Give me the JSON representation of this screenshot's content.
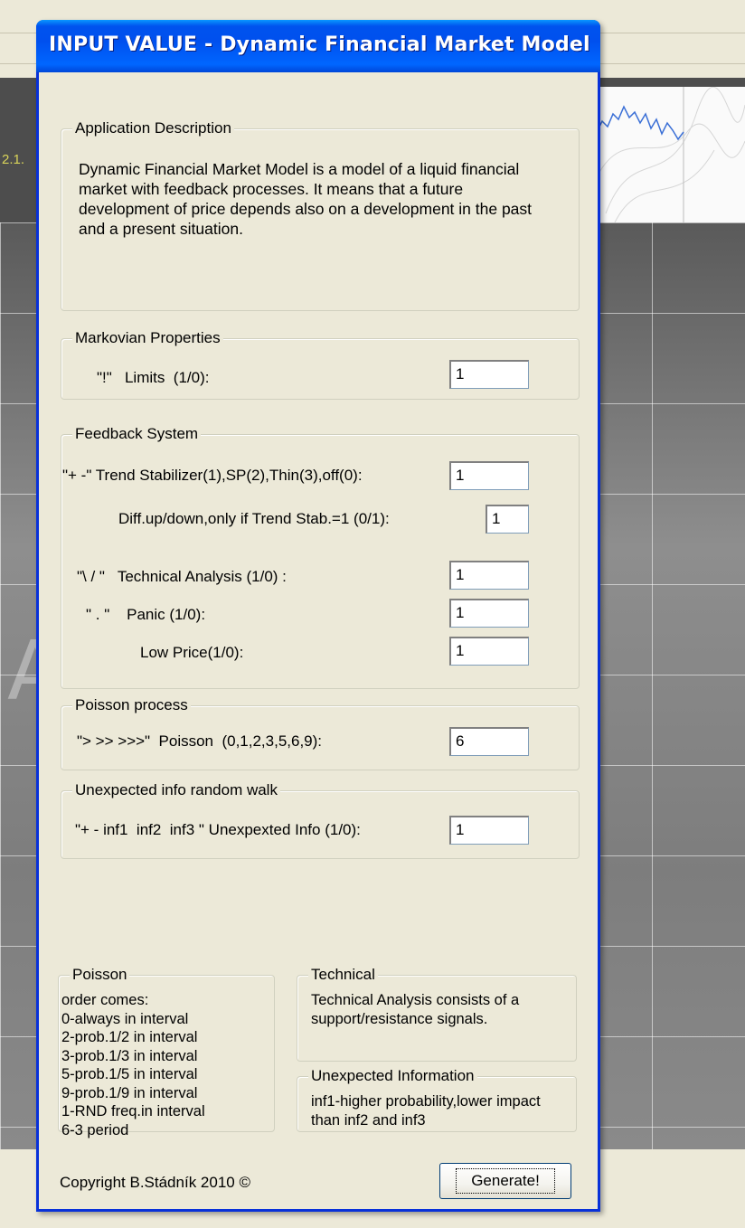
{
  "background": {
    "strip_text": "2.1.",
    "big_letter": "A"
  },
  "dialog": {
    "title": "INPUT VALUE - Dynamic Financial Market Model"
  },
  "app_description": {
    "legend": "Application Description",
    "text": "Dynamic Financial Market Model is a model of a liquid financial market with  feedback processes. It means that a future development of price depends also on a development in the past and a present situation."
  },
  "markovian": {
    "legend": "Markovian Properties",
    "limits_label": "\"!\"   Limits  (1/0):",
    "limits_value": "1"
  },
  "feedback": {
    "legend": "Feedback System",
    "trend_label": "\"+ -\" Trend Stabilizer(1),SP(2),Thin(3),off(0):",
    "trend_value": "1",
    "diff_label": "Diff.up/down,only if Trend Stab.=1 (0/1):",
    "diff_value": "1",
    "technical_label": "\"\\ / \"   Technical Analysis (1/0) :",
    "technical_value": "1",
    "panic_label": "\" . \"    Panic (1/0):",
    "panic_value": "1",
    "lowprice_label": "Low Price(1/0):",
    "lowprice_value": "1"
  },
  "poisson_process": {
    "legend": "Poisson process",
    "label": "\"> >> >>>\"  Poisson  (0,1,2,3,5,6,9):",
    "value": "6"
  },
  "unexpected_walk": {
    "legend": "Unexpected info random walk",
    "label": "\"+ - inf1  inf2  inf3 \" Unexpexted Info (1/0):",
    "value": "1"
  },
  "poisson_info": {
    "legend": "Poisson",
    "lines": [
      "order comes:",
      "0-always in interval",
      "2-prob.1/2 in interval",
      "3-prob.1/3 in interval",
      "5-prob.1/5 in interval",
      "9-prob.1/9 in interval",
      "1-RND freq.in interval",
      "6-3 period"
    ]
  },
  "technical_info": {
    "legend": "Technical",
    "text": "Technical  Analysis consists of a support/resistance signals."
  },
  "unexpected_info": {
    "legend": "Unexpected Information",
    "text": "inf1-higher probability,lower impact than inf2 and inf3"
  },
  "footer": {
    "copyright": "Copyright B.Stádník 2010 ©",
    "generate_label": "Generate!"
  }
}
